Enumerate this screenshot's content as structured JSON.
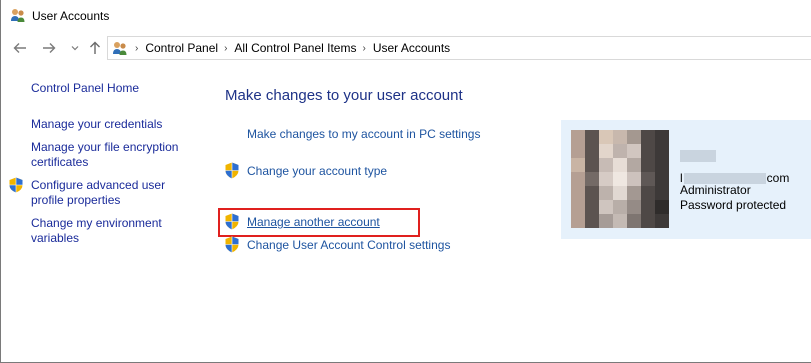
{
  "window": {
    "title": "User Accounts"
  },
  "nav": {
    "back_icon": "arrow-left-icon",
    "forward_icon": "arrow-right-icon",
    "recent_icon": "chevron-down-icon",
    "up_icon": "arrow-up-icon"
  },
  "breadcrumb": {
    "items": [
      "Control Panel",
      "All Control Panel Items",
      "User Accounts"
    ]
  },
  "left_panel": {
    "home": "Control Panel Home",
    "credentials": "Manage your credentials",
    "encryption_line1": "Manage your file encryption",
    "encryption_line2": "certificates",
    "advanced_line1": "Configure advanced user",
    "advanced_line2": "profile properties",
    "environment_line1": "Change my environment",
    "environment_line2": "variables"
  },
  "main": {
    "title": "Make changes to your user account",
    "tasks": {
      "pc_settings": "Make changes to my account in PC settings",
      "account_type": "Change your account type",
      "manage_another": "Manage another account",
      "uac_settings": "Change User Account Control settings"
    }
  },
  "account": {
    "email_prefix": "l",
    "email_suffix": "com",
    "role": "Administrator",
    "status": "Password protected"
  },
  "colors": {
    "link": "#1e54a0",
    "heading": "#1e3287",
    "highlight": "#e0201e",
    "card_bg": "#e6f1fb"
  }
}
